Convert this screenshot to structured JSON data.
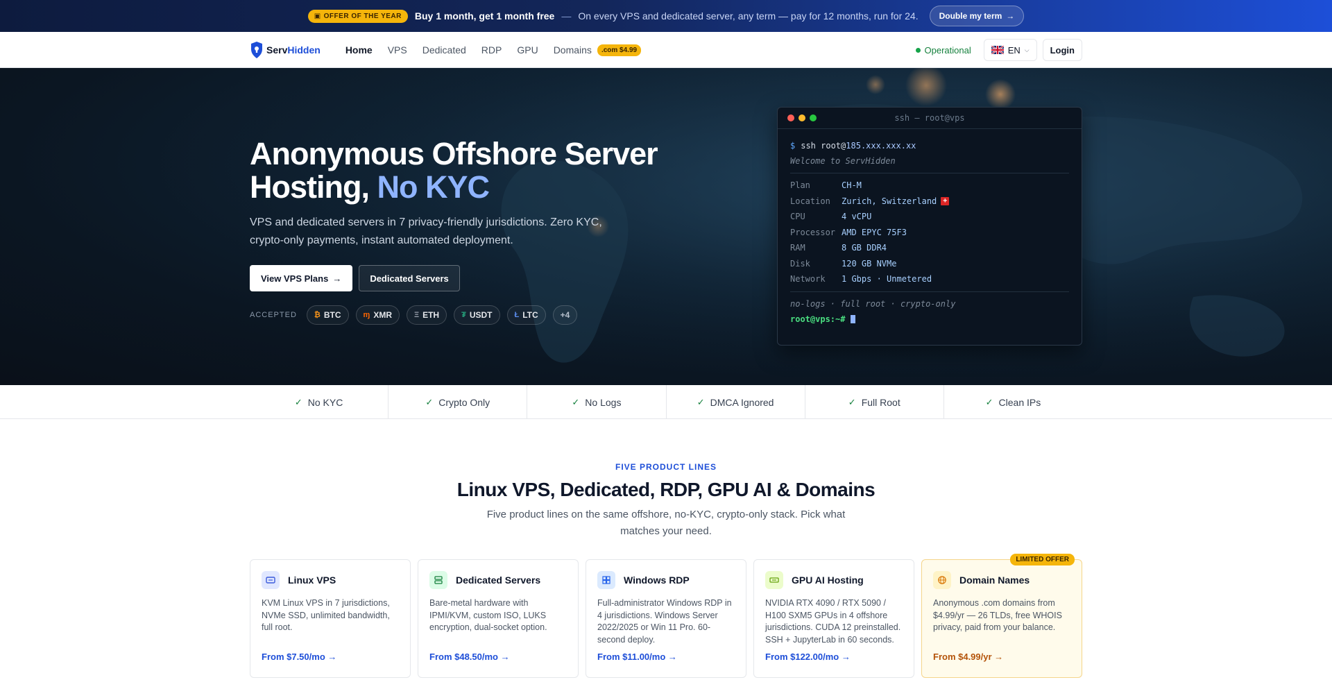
{
  "promo": {
    "badge": "OFFER OF THE YEAR",
    "headline": "Buy 1 month, get 1 month free",
    "dash": "—",
    "text": "On every VPS and dedicated server, any term — pay for 12 months, run for 24.",
    "button": "Double my term"
  },
  "nav": {
    "logo_main": "Serv",
    "logo_hl": "Hidden",
    "links": [
      "Home",
      "VPS",
      "Dedicated",
      "RDP",
      "GPU",
      "Domains"
    ],
    "domain_badge": ".com $4.99",
    "status": "Operational",
    "language": "EN",
    "login": "Login"
  },
  "hero": {
    "title_main": "Anonymous Offshore Server Hosting,",
    "title_accent": "No KYC",
    "subtitle": "VPS and dedicated servers in 7 privacy-friendly jurisdictions. Zero KYC, crypto-only payments, instant automated deployment.",
    "cta_primary": "View VPS Plans",
    "cta_secondary": "Dedicated Servers",
    "accepted_label": "ACCEPTED",
    "coins": [
      {
        "symbol": "₿",
        "name": "BTC",
        "color": "#f7931a"
      },
      {
        "symbol": "ɱ",
        "name": "XMR",
        "color": "#ff6600"
      },
      {
        "symbol": "Ξ",
        "name": "ETH",
        "color": "#9ca3af"
      },
      {
        "symbol": "₮",
        "name": "USDT",
        "color": "#26a17b"
      },
      {
        "symbol": "Ł",
        "name": "LTC",
        "color": "#5b8def"
      }
    ],
    "coins_more": "+4"
  },
  "terminal": {
    "title": "ssh — root@vps",
    "prompt": "$",
    "command": "ssh root@",
    "host": "185.xxx.xxx.xx",
    "welcome": "Welcome to ServHidden",
    "specs": [
      {
        "key": "Plan",
        "value": "CH-M"
      },
      {
        "key": "Location",
        "value": "Zurich, Switzerland"
      },
      {
        "key": "CPU",
        "value": "4 vCPU"
      },
      {
        "key": "Processor",
        "value": "AMD EPYC 75F3"
      },
      {
        "key": "RAM",
        "value": "8 GB DDR4"
      },
      {
        "key": "Disk",
        "value": "120 GB NVMe"
      },
      {
        "key": "Network",
        "value": "1 Gbps · Unmetered"
      }
    ],
    "footer": "no-logs · full root · crypto-only",
    "root_prompt": "root@vps:~#"
  },
  "features": [
    "No KYC",
    "Crypto Only",
    "No Logs",
    "DMCA Ignored",
    "Full Root",
    "Clean IPs"
  ],
  "products": {
    "eyebrow": "FIVE PRODUCT LINES",
    "title": "Linux VPS, Dedicated, RDP, GPU AI & Domains",
    "subtitle": "Five product lines on the same offshore, no-KYC, crypto-only stack. Pick what matches your need.",
    "cards": [
      {
        "icon": "server-icon",
        "icon_bg": "#e0e7ff",
        "icon_color": "#3b5bdb",
        "title": "Linux VPS",
        "desc": "KVM Linux VPS in 7 jurisdictions, NVMe SSD, unlimited bandwidth, full root.",
        "price": "From $7.50/mo →"
      },
      {
        "icon": "database-icon",
        "icon_bg": "#dcfce7",
        "icon_color": "#15803d",
        "title": "Dedicated Servers",
        "desc": "Bare-metal hardware with IPMI/KVM, custom ISO, LUKS encryption, dual-socket option.",
        "price": "From $48.50/mo →"
      },
      {
        "icon": "windows-icon",
        "icon_bg": "#dbeafe",
        "icon_color": "#2563eb",
        "title": "Windows RDP",
        "desc": "Full-administrator Windows RDP in 4 jurisdictions. Windows Server 2022/2025 or Win 11 Pro. 60-second deploy.",
        "price": "From $11.00/mo →"
      },
      {
        "icon": "gpu-icon",
        "icon_bg": "#ecfccb",
        "icon_color": "#65a30d",
        "title": "GPU AI Hosting",
        "desc": "NVIDIA RTX 4090 / RTX 5090 / H100 SXM5 GPUs in 4 offshore jurisdictions. CUDA 12 preinstalled. SSH + JupyterLab in 60 seconds.",
        "price": "From $122.00/mo →"
      },
      {
        "icon": "globe-icon",
        "icon_bg": "#fef3c7",
        "icon_color": "#d97706",
        "title": "Domain Names",
        "desc": "Anonymous .com domains from $4.99/yr — 26 TLDs, free WHOIS privacy, paid from your balance.",
        "price": "From $4.99/yr →",
        "badge": "LIMITED OFFER"
      }
    ]
  },
  "colors": {
    "accent": "#1d4ed8",
    "promo_badge": "#f5b50b",
    "hero_bg": "#0b1622",
    "status_green": "#16a34a"
  }
}
